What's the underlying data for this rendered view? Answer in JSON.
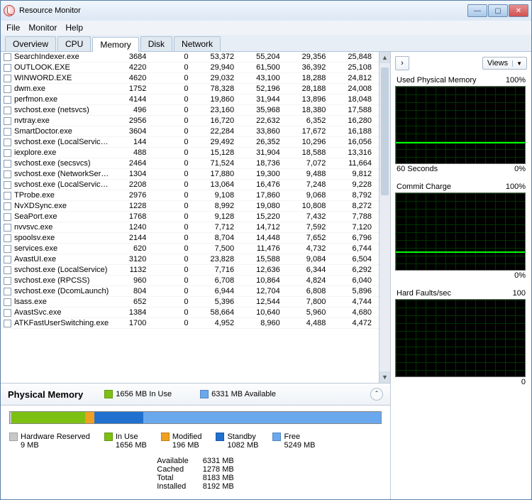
{
  "window": {
    "title": "Resource Monitor"
  },
  "menu": [
    "File",
    "Monitor",
    "Help"
  ],
  "tabs": [
    "Overview",
    "CPU",
    "Memory",
    "Disk",
    "Network"
  ],
  "activeTab": "Memory",
  "views_label": "Views",
  "processes": [
    {
      "name": "SearchIndexer.exe",
      "pid": "3684",
      "hf": "0",
      "commit": "53,372",
      "ws": "55,204",
      "share": "29,356",
      "priv": "25,848"
    },
    {
      "name": "OUTLOOK.EXE",
      "pid": "4220",
      "hf": "0",
      "commit": "29,940",
      "ws": "61,500",
      "share": "36,392",
      "priv": "25,108"
    },
    {
      "name": "WINWORD.EXE",
      "pid": "4620",
      "hf": "0",
      "commit": "29,032",
      "ws": "43,100",
      "share": "18,288",
      "priv": "24,812"
    },
    {
      "name": "dwm.exe",
      "pid": "1752",
      "hf": "0",
      "commit": "78,328",
      "ws": "52,196",
      "share": "28,188",
      "priv": "24,008"
    },
    {
      "name": "perfmon.exe",
      "pid": "4144",
      "hf": "0",
      "commit": "19,860",
      "ws": "31,944",
      "share": "13,896",
      "priv": "18,048"
    },
    {
      "name": "svchost.exe (netsvcs)",
      "pid": "496",
      "hf": "0",
      "commit": "23,160",
      "ws": "35,968",
      "share": "18,380",
      "priv": "17,588"
    },
    {
      "name": "nvtray.exe",
      "pid": "2956",
      "hf": "0",
      "commit": "16,720",
      "ws": "22,632",
      "share": "6,352",
      "priv": "16,280"
    },
    {
      "name": "SmartDoctor.exe",
      "pid": "3604",
      "hf": "0",
      "commit": "22,284",
      "ws": "33,860",
      "share": "17,672",
      "priv": "16,188"
    },
    {
      "name": "svchost.exe (LocalServiceNet...",
      "pid": "144",
      "hf": "0",
      "commit": "29,492",
      "ws": "26,352",
      "share": "10,296",
      "priv": "16,056"
    },
    {
      "name": "iexplore.exe",
      "pid": "488",
      "hf": "0",
      "commit": "15,128",
      "ws": "31,904",
      "share": "18,588",
      "priv": "13,316"
    },
    {
      "name": "svchost.exe (secsvcs)",
      "pid": "2464",
      "hf": "0",
      "commit": "71,524",
      "ws": "18,736",
      "share": "7,072",
      "priv": "11,664"
    },
    {
      "name": "svchost.exe (NetworkService)",
      "pid": "1304",
      "hf": "0",
      "commit": "17,880",
      "ws": "19,300",
      "share": "9,488",
      "priv": "9,812"
    },
    {
      "name": "svchost.exe (LocalServiceNo...",
      "pid": "2208",
      "hf": "0",
      "commit": "13,064",
      "ws": "16,476",
      "share": "7,248",
      "priv": "9,228"
    },
    {
      "name": "TProbe.exe",
      "pid": "2976",
      "hf": "0",
      "commit": "9,108",
      "ws": "17,860",
      "share": "9,068",
      "priv": "8,792"
    },
    {
      "name": "NvXDSync.exe",
      "pid": "1228",
      "hf": "0",
      "commit": "8,992",
      "ws": "19,080",
      "share": "10,808",
      "priv": "8,272"
    },
    {
      "name": "SeaPort.exe",
      "pid": "1768",
      "hf": "0",
      "commit": "9,128",
      "ws": "15,220",
      "share": "7,432",
      "priv": "7,788"
    },
    {
      "name": "nvvsvc.exe",
      "pid": "1240",
      "hf": "0",
      "commit": "7,712",
      "ws": "14,712",
      "share": "7,592",
      "priv": "7,120"
    },
    {
      "name": "spoolsv.exe",
      "pid": "2144",
      "hf": "0",
      "commit": "8,704",
      "ws": "14,448",
      "share": "7,652",
      "priv": "6,796"
    },
    {
      "name": "services.exe",
      "pid": "620",
      "hf": "0",
      "commit": "7,500",
      "ws": "11,476",
      "share": "4,732",
      "priv": "6,744"
    },
    {
      "name": "AvastUI.exe",
      "pid": "3120",
      "hf": "0",
      "commit": "23,828",
      "ws": "15,588",
      "share": "9,084",
      "priv": "6,504"
    },
    {
      "name": "svchost.exe (LocalService)",
      "pid": "1132",
      "hf": "0",
      "commit": "7,716",
      "ws": "12,636",
      "share": "6,344",
      "priv": "6,292"
    },
    {
      "name": "svchost.exe (RPCSS)",
      "pid": "960",
      "hf": "0",
      "commit": "6,708",
      "ws": "10,864",
      "share": "4,824",
      "priv": "6,040"
    },
    {
      "name": "svchost.exe (DcomLaunch)",
      "pid": "804",
      "hf": "0",
      "commit": "6,944",
      "ws": "12,704",
      "share": "6,808",
      "priv": "5,896"
    },
    {
      "name": "lsass.exe",
      "pid": "652",
      "hf": "0",
      "commit": "5,396",
      "ws": "12,544",
      "share": "7,800",
      "priv": "4,744"
    },
    {
      "name": "AvastSvc.exe",
      "pid": "1384",
      "hf": "0",
      "commit": "58,664",
      "ws": "10,640",
      "share": "5,960",
      "priv": "4,680"
    },
    {
      "name": "ATKFastUserSwitching.exe",
      "pid": "1700",
      "hf": "0",
      "commit": "4,952",
      "ws": "8,960",
      "share": "4,488",
      "priv": "4,472"
    }
  ],
  "phys": {
    "title": "Physical Memory",
    "inuse_summary": "1656 MB In Use",
    "avail_summary": "6331 MB Available",
    "legend": {
      "hw": {
        "label": "Hardware Reserved",
        "val": "9 MB",
        "color": "#c8c8c8"
      },
      "inuse": {
        "label": "In Use",
        "val": "1656 MB",
        "color": "#7cc014"
      },
      "mod": {
        "label": "Modified",
        "val": "196 MB",
        "color": "#f0a020"
      },
      "standby": {
        "label": "Standby",
        "val": "1082 MB",
        "color": "#2070d0"
      },
      "free": {
        "label": "Free",
        "val": "5249 MB",
        "color": "#6aa8ee"
      }
    },
    "stats": {
      "Available": "6331 MB",
      "Cached": "1278 MB",
      "Total": "8183 MB",
      "Installed": "8192 MB"
    }
  },
  "graphs": {
    "g1": {
      "title": "Used Physical Memory",
      "max": "100%",
      "footL": "60 Seconds",
      "footR": "0%",
      "linepos": 78
    },
    "g2": {
      "title": "Commit Charge",
      "max": "100%",
      "footR": "0%",
      "linepos": 82
    },
    "g3": {
      "title": "Hard Faults/sec",
      "max": "100",
      "footR": "0",
      "linepos": 108
    }
  },
  "colors": {
    "hw": "#c8c8c8",
    "inuse": "#7cc014",
    "mod": "#f0a020",
    "standby": "#2070d0",
    "free": "#6aa8ee"
  }
}
